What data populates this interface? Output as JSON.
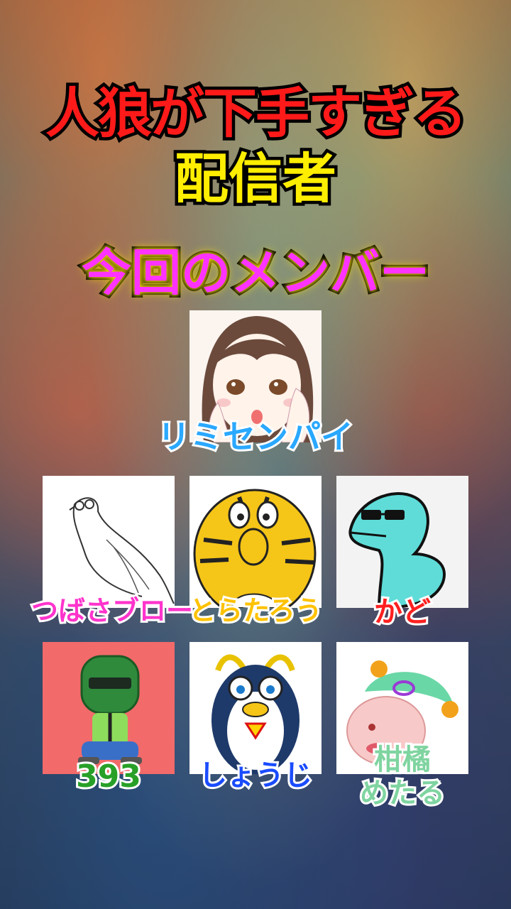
{
  "title": {
    "line1": "人狼が下手すぎる",
    "line2": "配信者",
    "subtitle": "今回のメンバー"
  },
  "members": [
    {
      "name": "リミセンパイ",
      "color": "#2aa8ff",
      "icon": "girl-illustration-icon"
    },
    {
      "name": "つばさブロー",
      "color": "#ff33cc",
      "icon": "bird-sketch-icon"
    },
    {
      "name": "とらたろう",
      "color": "#ffc200",
      "icon": "tiger-icon"
    },
    {
      "name": "かど",
      "color": "#ff2020",
      "icon": "blue-dinosaur-icon"
    },
    {
      "name": "393",
      "color": "#28a028",
      "icon": "green-helmet-character-icon"
    },
    {
      "name": "しょうじ",
      "color": "#1a4cff",
      "icon": "penguin-icon"
    },
    {
      "name": "柑橘めたる",
      "name_line1": "柑橘",
      "name_line2": "めたる",
      "color": "#7fd4a0",
      "icon": "pink-face-character-icon"
    }
  ]
}
